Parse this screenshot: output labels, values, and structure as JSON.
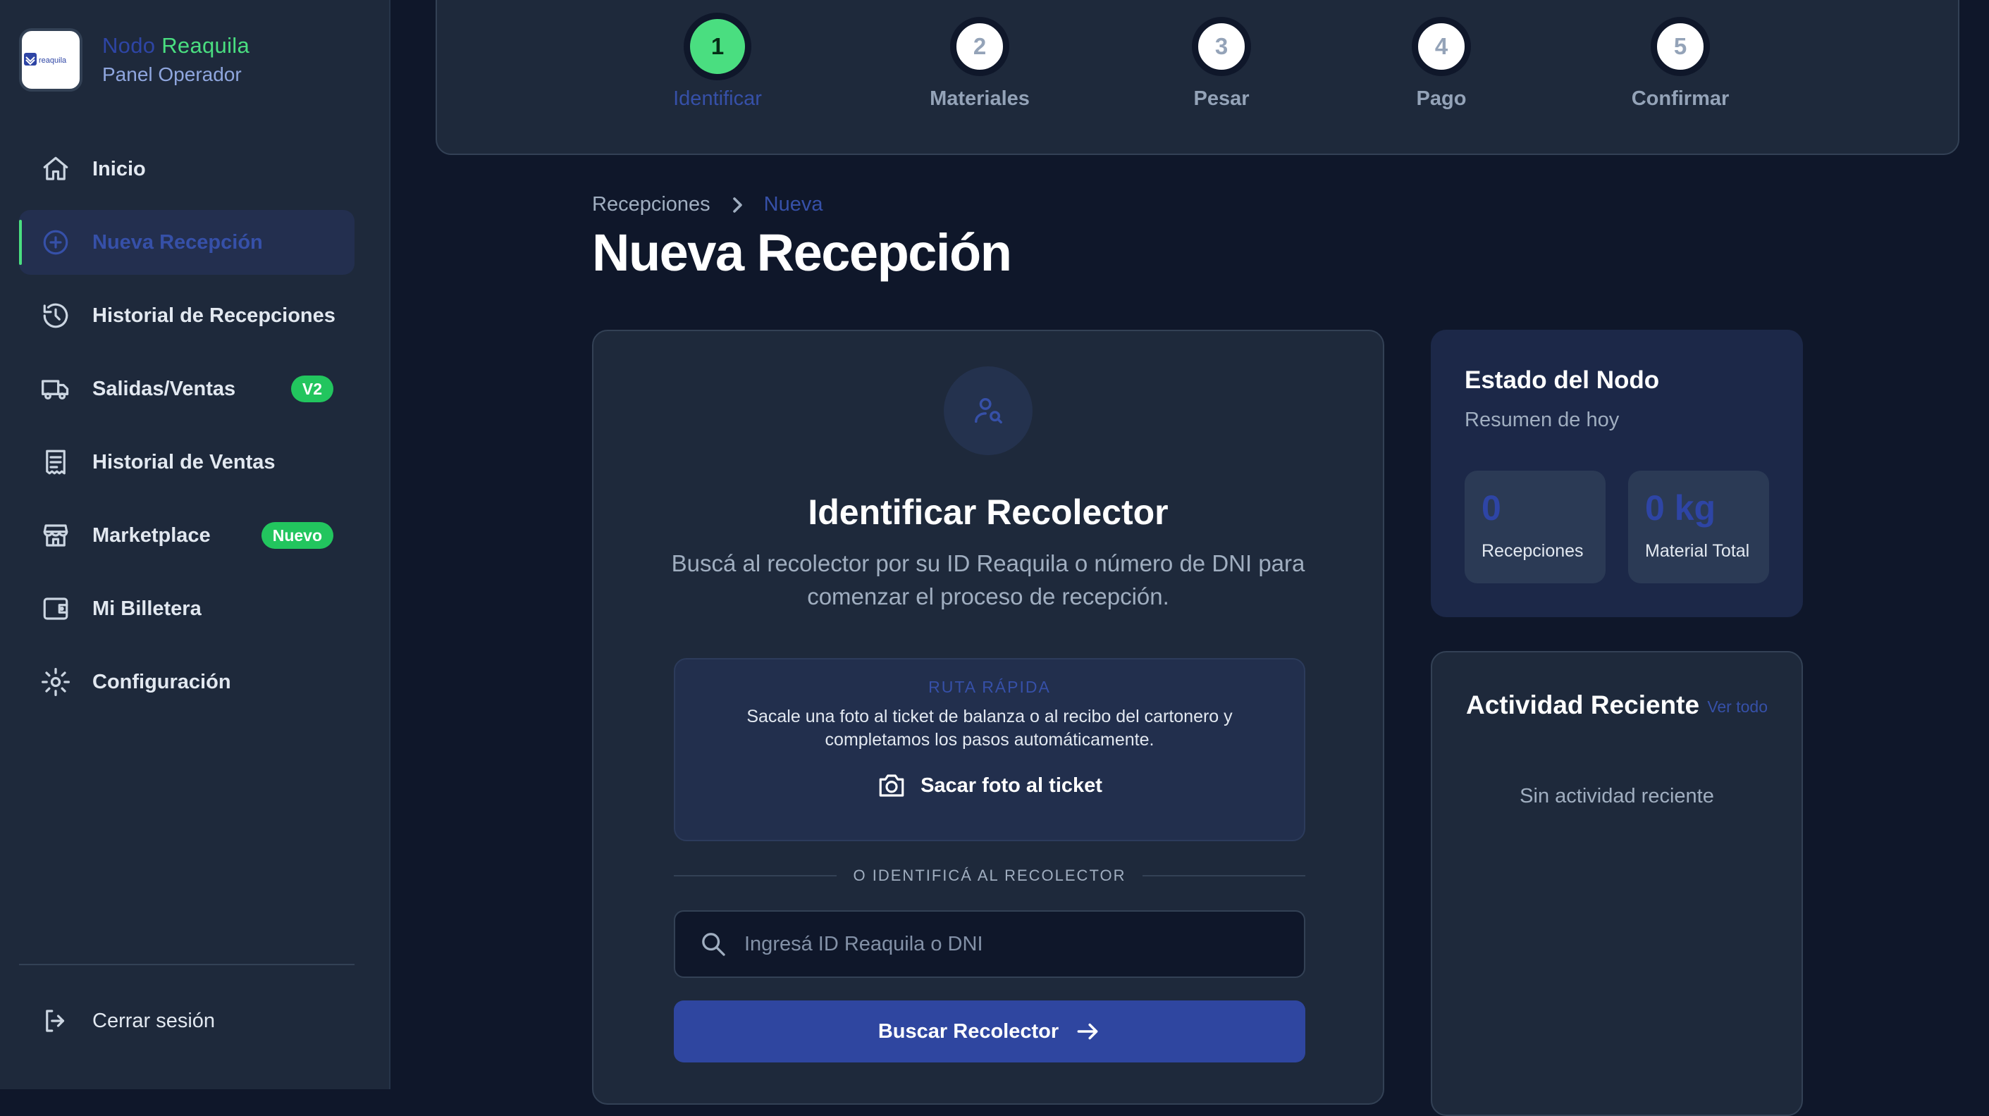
{
  "brand": {
    "title_part1": "Nodo",
    "title_part2": "Reaquila",
    "subtitle": "Panel Operador",
    "logo_text": "reaquila"
  },
  "sidebar": {
    "items": [
      {
        "label": "Inicio",
        "icon": "home-icon"
      },
      {
        "label": "Nueva Recepción",
        "icon": "plus-circle-icon",
        "active": true
      },
      {
        "label": "Historial de Recepciones",
        "icon": "history-icon"
      },
      {
        "label": "Salidas/Ventas",
        "icon": "truck-icon",
        "badge": "V2"
      },
      {
        "label": "Historial de Ventas",
        "icon": "receipt-icon"
      },
      {
        "label": "Marketplace",
        "icon": "store-icon",
        "badge": "Nuevo"
      },
      {
        "label": "Mi Billetera",
        "icon": "wallet-icon"
      },
      {
        "label": "Configuración",
        "icon": "gear-icon"
      }
    ],
    "logout_label": "Cerrar sesión"
  },
  "stepper": {
    "steps": [
      {
        "number": "1",
        "label": "Identificar",
        "active": true
      },
      {
        "number": "2",
        "label": "Materiales"
      },
      {
        "number": "3",
        "label": "Pesar"
      },
      {
        "number": "4",
        "label": "Pago"
      },
      {
        "number": "5",
        "label": "Confirmar"
      }
    ]
  },
  "breadcrumb": {
    "parent": "Recepciones",
    "current": "Nueva"
  },
  "page_title": "Nueva Recepción",
  "identify_card": {
    "icon": "user-search-icon",
    "title": "Identificar Recolector",
    "description": "Buscá al recolector por su ID Reaquila o número de DNI para comenzar el proceso de recepción.",
    "quick_route": {
      "label": "RUTA RÁPIDA",
      "text": "Sacale una foto al ticket de balanza o al recibo del cartonero y completamos los pasos automáticamente.",
      "button_label": "Sacar foto al ticket"
    },
    "divider_text": "O IDENTIFICÁ AL RECOLECTOR",
    "search": {
      "placeholder": "Ingresá ID Reaquila o DNI",
      "value": ""
    },
    "submit_label": "Buscar Recolector"
  },
  "node_status": {
    "title": "Estado del Nodo",
    "subtitle": "Resumen de hoy",
    "stats": [
      {
        "value": "0",
        "label": "Recepciones"
      },
      {
        "value": "0 kg",
        "label": "Material Total"
      }
    ]
  },
  "recent_activity": {
    "title": "Actividad Reciente",
    "link_label": "Ver todo",
    "empty_text": "Sin actividad reciente"
  },
  "colors": {
    "background": "#0f172a",
    "panel": "#1e293b",
    "accent_green": "#4ade80",
    "accent_blue": "#2f46a0"
  }
}
